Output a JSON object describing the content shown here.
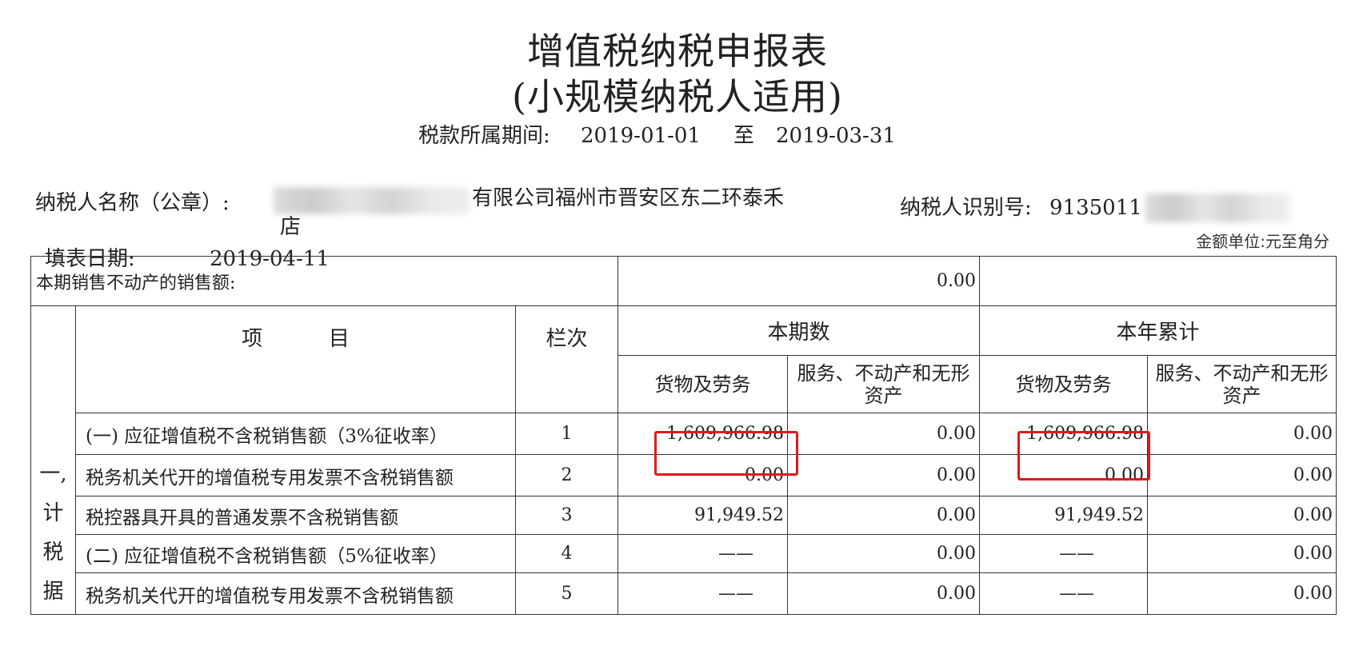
{
  "title": "增值税纳税申报表",
  "subtitle": "(小规模纳税人适用)",
  "period": {
    "label": "税款所属期间:",
    "start": "2019-01-01",
    "to": "至",
    "end": "2019-03-31"
  },
  "taxpayer": {
    "name_label": "纳税人名称（公章）:",
    "name_visible_line1": "有限公司福州市晋安区东二环泰禾",
    "name_visible_line2": "店",
    "id_label": "纳税人识别号:",
    "id_visible": "9135011"
  },
  "fill_date": {
    "label": "填表日期:",
    "value": "2019-04-11"
  },
  "unit_note": "金额单位:元至角分",
  "table": {
    "real_estate_label": "本期销售不动产的销售额:",
    "real_estate_value": "0.00",
    "header": {
      "item": "项          目",
      "col_no": "栏次",
      "current_period": "本期数",
      "ytd": "本年累计",
      "goods_services": "货物及劳务",
      "services_estate": "服务、不动产和无形资产"
    },
    "section_label_chars": [
      "一,",
      "计",
      "税",
      "据"
    ],
    "rows": [
      {
        "item": "(一) 应征增值税不含税销售额（3%征收率）",
        "no": "1",
        "cur_goods": "1,609,966.98",
        "cur_services": "0.00",
        "ytd_goods": "1,609,966.98",
        "ytd_services": "0.00"
      },
      {
        "item": "税务机关代开的增值税专用发票不含税销售额",
        "no": "2",
        "cur_goods": "0.00",
        "cur_services": "0.00",
        "ytd_goods": "0.00",
        "ytd_services": "0.00"
      },
      {
        "item": "税控器具开具的普通发票不含税销售额",
        "no": "3",
        "cur_goods": "91,949.52",
        "cur_services": "0.00",
        "ytd_goods": "91,949.52",
        "ytd_services": "0.00"
      },
      {
        "item": "(二) 应征增值税不含税销售额（5%征收率）",
        "no": "4",
        "cur_goods": "——",
        "cur_services": "0.00",
        "ytd_goods": "——",
        "ytd_services": "0.00"
      },
      {
        "item": "税务机关代开的增值税专用发票不含税销售额",
        "no": "5",
        "cur_goods": "——",
        "cur_services": "0.00",
        "ytd_goods": "——",
        "ytd_services": "0.00"
      }
    ]
  },
  "highlight_color": "#e0191c"
}
